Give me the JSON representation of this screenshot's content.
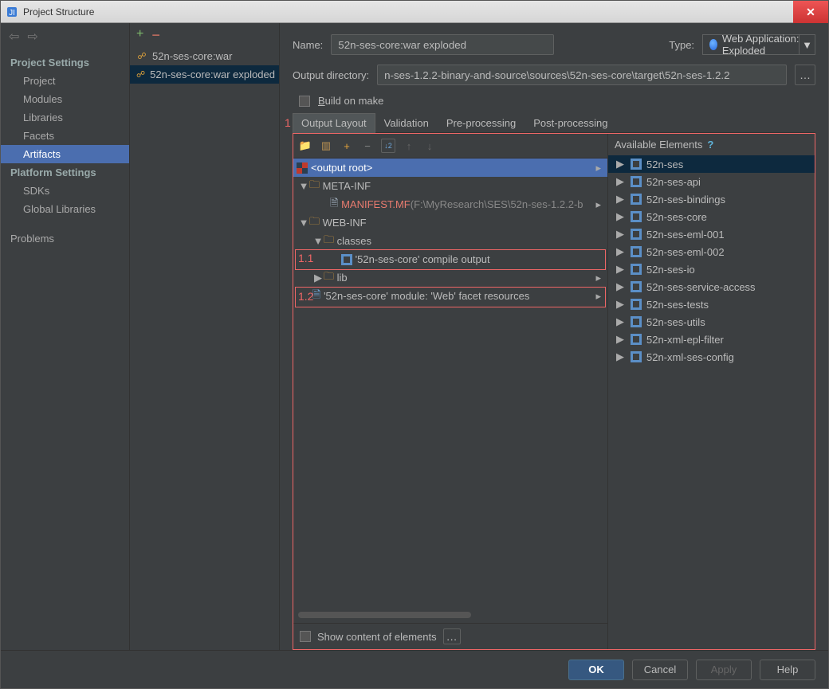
{
  "title": "Project Structure",
  "sidebar": {
    "cat1": "Project Settings",
    "items1": [
      "Project",
      "Modules",
      "Libraries",
      "Facets",
      "Artifacts"
    ],
    "cat2": "Platform Settings",
    "items2": [
      "SDKs",
      "Global Libraries"
    ],
    "problems": "Problems"
  },
  "artifactList": [
    "52n-ses-core:war",
    "52n-ses-core:war exploded"
  ],
  "form": {
    "nameLabel": "Name:",
    "name": "52n-ses-core:war exploded",
    "typeLabel": "Type:",
    "type": "Web Application: Exploded",
    "outDirLabel": "Output directory:",
    "outDir": "n-ses-1.2.2-binary-and-source\\sources\\52n-ses-core\\target\\52n-ses-1.2.2",
    "buildOnMake": "Build on make"
  },
  "tabs": [
    "Output Layout",
    "Validation",
    "Pre-processing",
    "Post-processing"
  ],
  "annotations": {
    "one": "1",
    "one1": "1.1",
    "one2": "1.2"
  },
  "tree": {
    "root": "<output root>",
    "metaInf": "META-INF",
    "manifest": "MANIFEST.MF",
    "manifestPath": "(F:\\MyResearch\\SES\\52n-ses-1.2.2-b",
    "webInf": "WEB-INF",
    "classes": "classes",
    "compileOut": "'52n-ses-core' compile output",
    "lib": "lib",
    "facetRes": "'52n-ses-core' module: 'Web' facet resources"
  },
  "available": {
    "header": "Available Elements",
    "items": [
      "52n-ses",
      "52n-ses-api",
      "52n-ses-bindings",
      "52n-ses-core",
      "52n-ses-eml-001",
      "52n-ses-eml-002",
      "52n-ses-io",
      "52n-ses-service-access",
      "52n-ses-tests",
      "52n-ses-utils",
      "52n-xml-epl-filter",
      "52n-xml-ses-config"
    ]
  },
  "showContent": "Show content of elements",
  "buttons": {
    "ok": "OK",
    "cancel": "Cancel",
    "apply": "Apply",
    "help": "Help"
  }
}
